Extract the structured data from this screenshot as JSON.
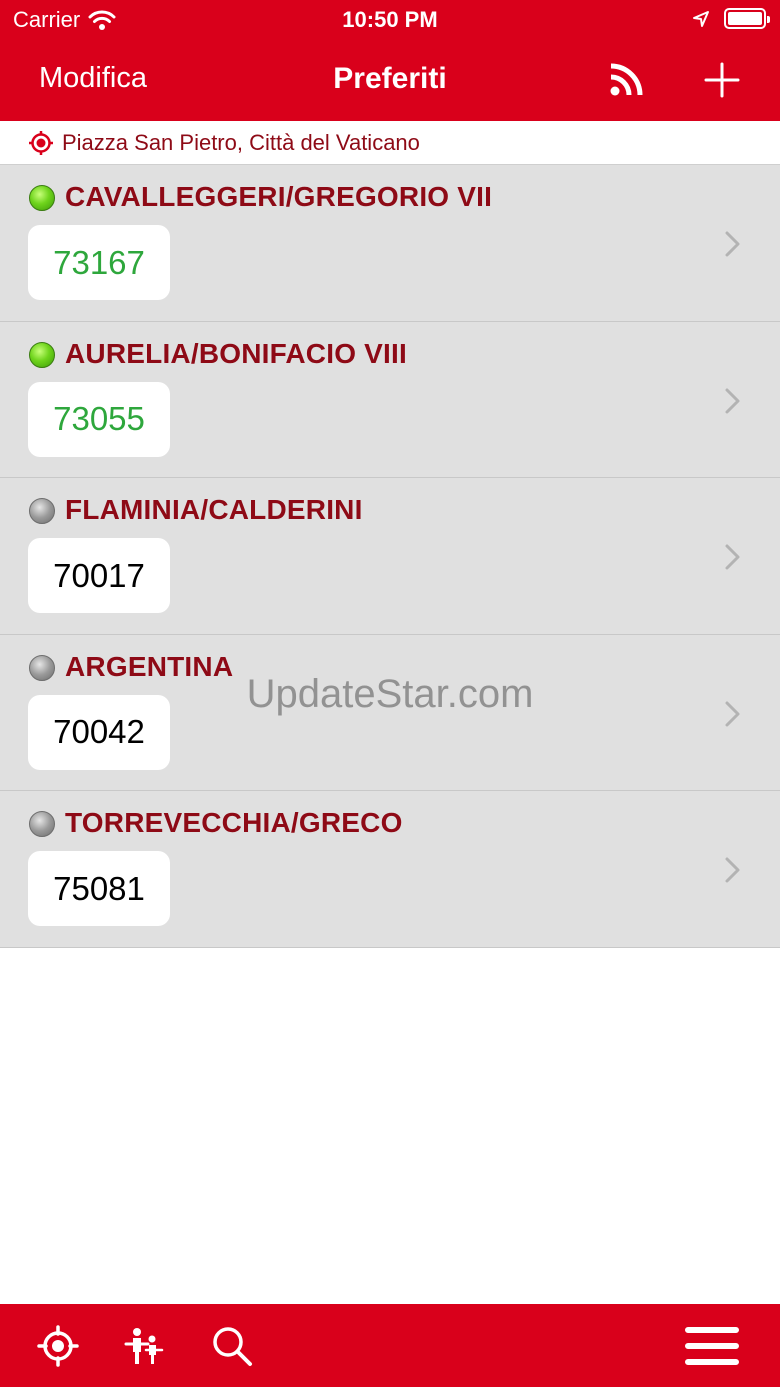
{
  "status_bar": {
    "carrier": "Carrier",
    "time": "10:50 PM"
  },
  "nav": {
    "edit_label": "Modifica",
    "title": "Preferiti"
  },
  "location": {
    "text": "Piazza San Pietro, Città del Vaticano"
  },
  "stops": [
    {
      "name": "CAVALLEGGERI/GREGORIO VII",
      "code": "73167",
      "status": "active"
    },
    {
      "name": "AURELIA/BONIFACIO VIII",
      "code": "73055",
      "status": "active"
    },
    {
      "name": "FLAMINIA/CALDERINI",
      "code": "70017",
      "status": "inactive"
    },
    {
      "name": "ARGENTINA",
      "code": "70042",
      "status": "inactive"
    },
    {
      "name": "TORREVECCHIA/GRECO",
      "code": "75081",
      "status": "inactive"
    }
  ],
  "watermark": "UpdateStar.com",
  "icons": {
    "wifi": "wifi-icon",
    "location_arrow": "location-arrow-icon",
    "battery": "battery-icon",
    "rss": "rss-icon",
    "add": "plus-icon",
    "location_target": "target-icon",
    "chevron": "chevron-right-icon",
    "nearby": "target-icon",
    "lines": "people-icon",
    "search": "search-icon",
    "menu": "hamburger-menu-icon"
  },
  "colors": {
    "brand_red": "#d9001b",
    "stop_name": "#8e0a16",
    "active_code": "#2ea73c",
    "active_dot": "#6fd41c",
    "inactive_dot": "#9a9a9a",
    "row_bg": "#e0e0e0"
  }
}
